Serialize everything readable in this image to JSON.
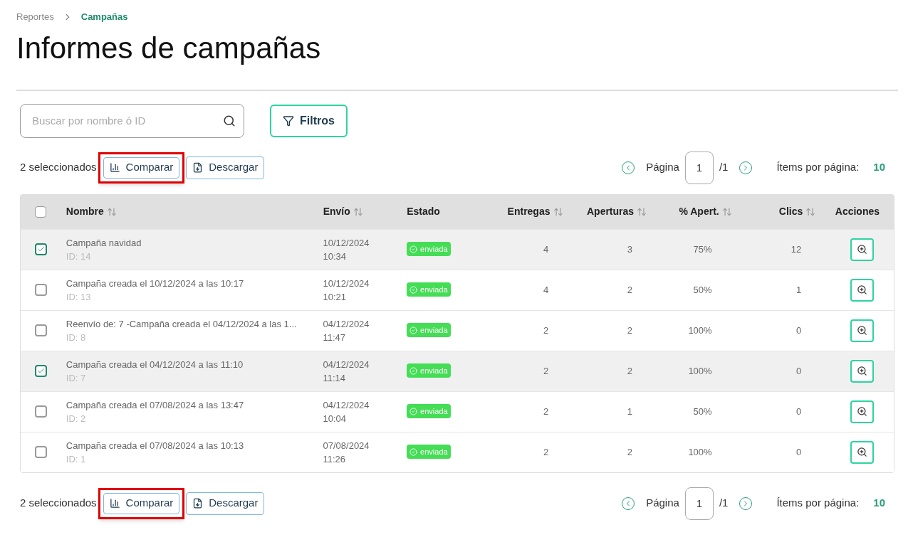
{
  "breadcrumb": [
    {
      "label": "Reportes",
      "selected": false
    },
    {
      "label": "Campañas",
      "selected": true
    }
  ],
  "title": "Informes de campañas",
  "search": {
    "placeholder": "Buscar por nombre ó ID"
  },
  "filter_button": "Filtros",
  "toolbars": [
    {
      "selected_count": "2 seleccionados",
      "compare": "Comparar",
      "compare_highlighted": true,
      "download": "Descargar",
      "page_label": "Página",
      "page": "1",
      "page_total": "/1",
      "items_label": "Ítems por página:",
      "items_value": "10"
    },
    {
      "selected_count": "2 seleccionados",
      "compare": "Comparar",
      "compare_highlighted": true,
      "download": "Descargar",
      "page_label": "Página",
      "page": "1",
      "page_total": "/1",
      "items_label": "Ítems por página:",
      "items_value": "10"
    }
  ],
  "table": {
    "all_selected": false,
    "columns": [
      {
        "label": "Nombre",
        "sortable": true
      },
      {
        "label": "Envío",
        "sortable": true
      },
      {
        "label": "Estado",
        "sortable": false
      },
      {
        "label": "Entregas",
        "sortable": true
      },
      {
        "label": "Aperturas",
        "sortable": true
      },
      {
        "label": "% Apert.",
        "sortable": true
      },
      {
        "label": "Clics",
        "sortable": true
      },
      {
        "label": "Acciones",
        "sortable": false
      }
    ],
    "rows": [
      {
        "selected": true,
        "name": "Campaña navidad",
        "id": "ID: 14",
        "date": "10/12/2024",
        "time": "10:34",
        "status": "enviada",
        "deliveries": "4",
        "opens": "3",
        "open_rate": "75%",
        "clicks": "12"
      },
      {
        "selected": false,
        "name": "Campaña creada el 10/12/2024 a las 10:17",
        "id": "ID: 13",
        "date": "10/12/2024",
        "time": "10:21",
        "status": "enviada",
        "deliveries": "4",
        "opens": "2",
        "open_rate": "50%",
        "clicks": "1"
      },
      {
        "selected": false,
        "name": "Reenvío de: 7 -Campaña creada el 04/12/2024 a las 1...",
        "id": "ID: 8",
        "date": "04/12/2024",
        "time": "11:47",
        "status": "enviada",
        "deliveries": "2",
        "opens": "2",
        "open_rate": "100%",
        "clicks": "0"
      },
      {
        "selected": true,
        "name": "Campaña creada el 04/12/2024 a las 11:10",
        "id": "ID: 7",
        "date": "04/12/2024",
        "time": "11:14",
        "status": "enviada",
        "deliveries": "2",
        "opens": "2",
        "open_rate": "100%",
        "clicks": "0"
      },
      {
        "selected": false,
        "name": "Campaña creada el 07/08/2024 a las 13:47",
        "id": "ID: 2",
        "date": "04/12/2024",
        "time": "10:04",
        "status": "enviada",
        "deliveries": "2",
        "opens": "1",
        "open_rate": "50%",
        "clicks": "0"
      },
      {
        "selected": false,
        "name": "Campaña creada el 07/08/2024 a las 10:13",
        "id": "ID: 1",
        "date": "07/08/2024",
        "time": "11:26",
        "status": "enviada",
        "deliveries": "2",
        "opens": "2",
        "open_rate": "100%",
        "clicks": "0"
      }
    ]
  }
}
